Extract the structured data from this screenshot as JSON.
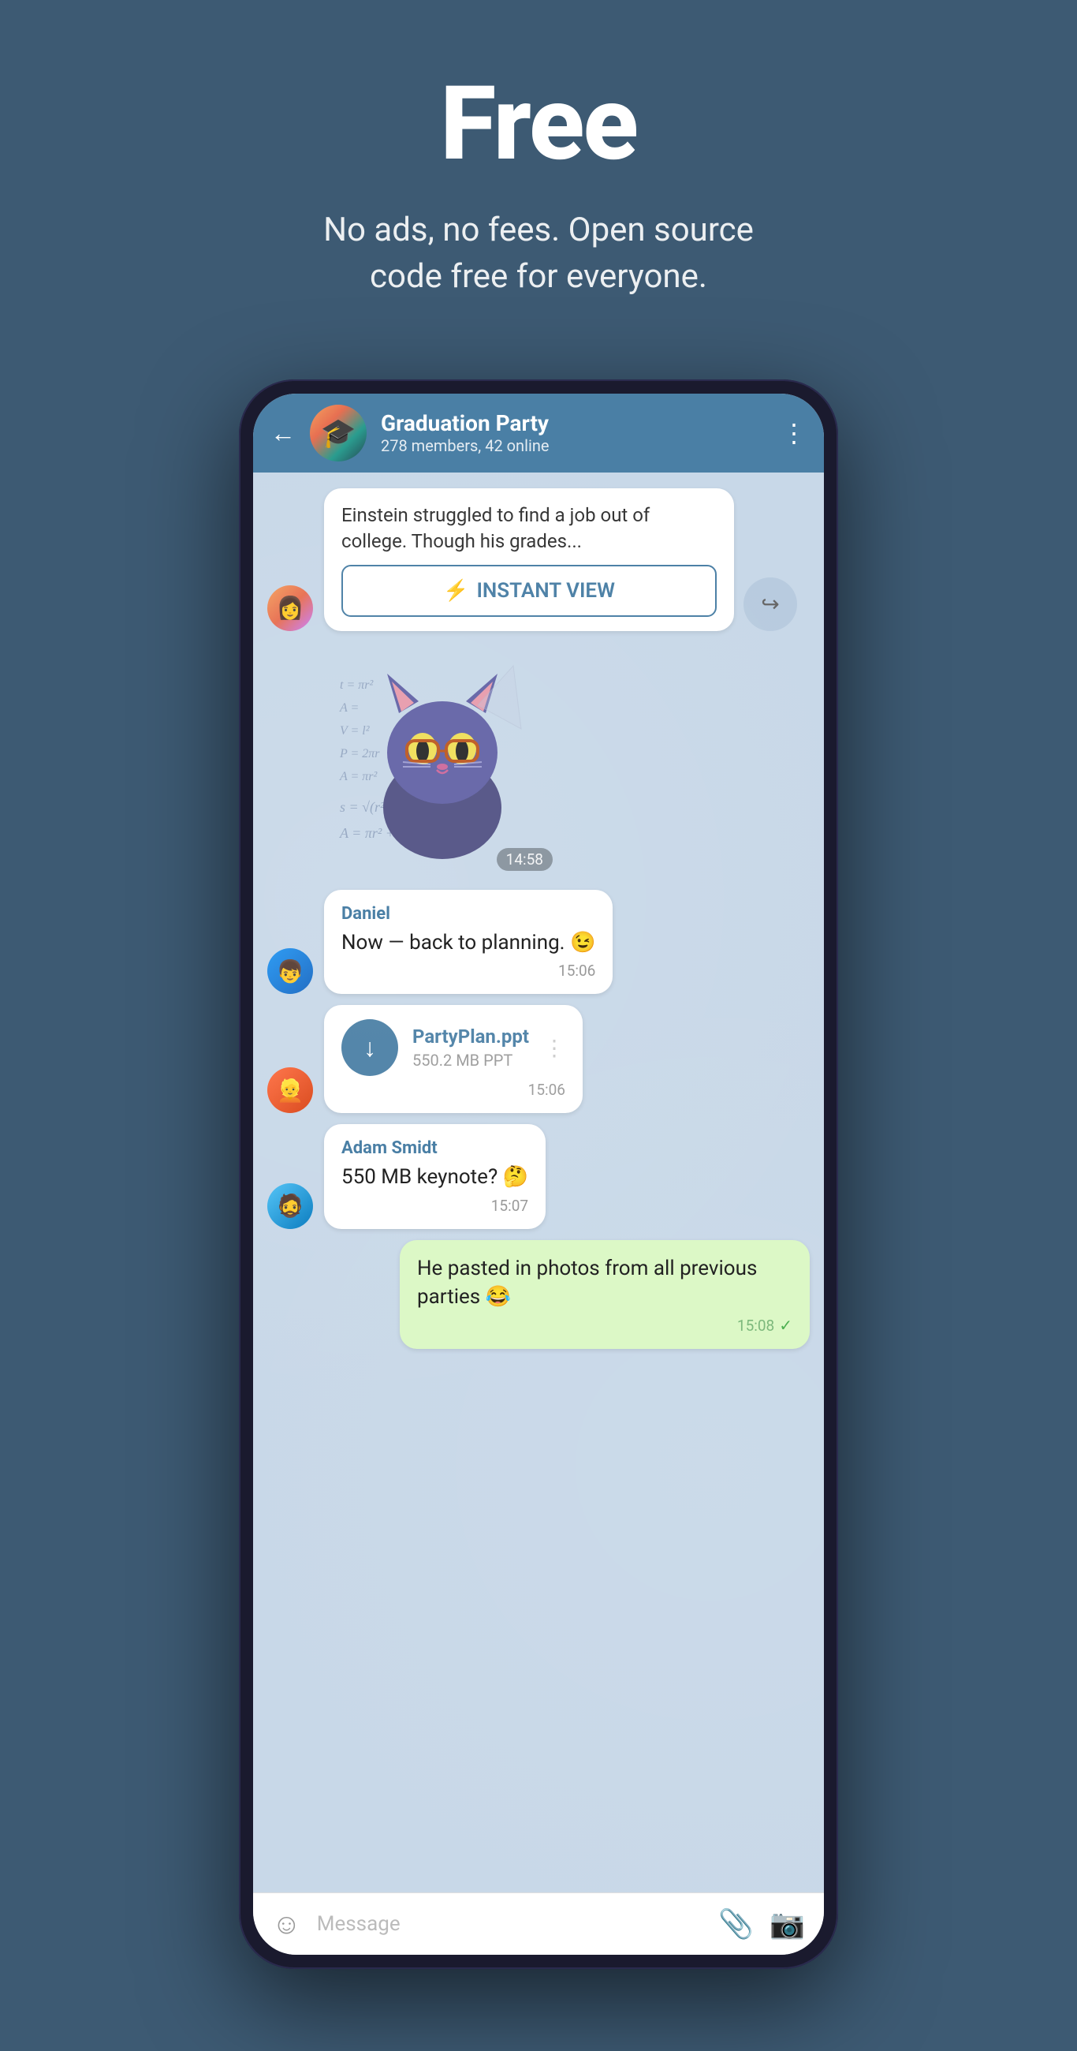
{
  "hero": {
    "title": "Free",
    "subtitle": "No ads, no fees. Open source\ncode free for everyone."
  },
  "header": {
    "back_label": "←",
    "group_name": "Graduation Party",
    "group_members": "278 members, 42 online",
    "more_icon": "⋮"
  },
  "messages": [
    {
      "id": "iv-card",
      "type": "instant_view",
      "article_text": "Einstein struggled to find a job out of college. Though his grades...",
      "button_label": "INSTANT VIEW",
      "lightning": "⚡"
    },
    {
      "id": "sticker",
      "type": "sticker",
      "time": "14:58"
    },
    {
      "id": "daniel-msg",
      "type": "bubble",
      "sender": "Daniel",
      "text": "Now — back to planning. 😉",
      "time": "15:06"
    },
    {
      "id": "file-msg",
      "type": "file",
      "filename": "PartyPlan.ppt",
      "filesize": "550.2 MB PPT",
      "time": "15:06"
    },
    {
      "id": "adam-msg",
      "type": "bubble",
      "sender": "Adam Smidt",
      "text": "550 MB keynote? 🤔",
      "time": "15:07"
    },
    {
      "id": "my-msg",
      "type": "bubble_right",
      "text": "He pasted in photos from all previous parties 😂",
      "time": "15:08",
      "tick": "✓"
    }
  ],
  "input_bar": {
    "placeholder": "Message",
    "emoji_icon": "☺",
    "attach_icon": "📎",
    "camera_icon": "📷"
  },
  "colors": {
    "bg": "#3d5a73",
    "header": "#4a7fa5",
    "chat_bg": "#c8d8e8",
    "bubble_white": "#ffffff",
    "bubble_green": "#dcf8c6",
    "sender_blue": "#4a7fa5"
  }
}
